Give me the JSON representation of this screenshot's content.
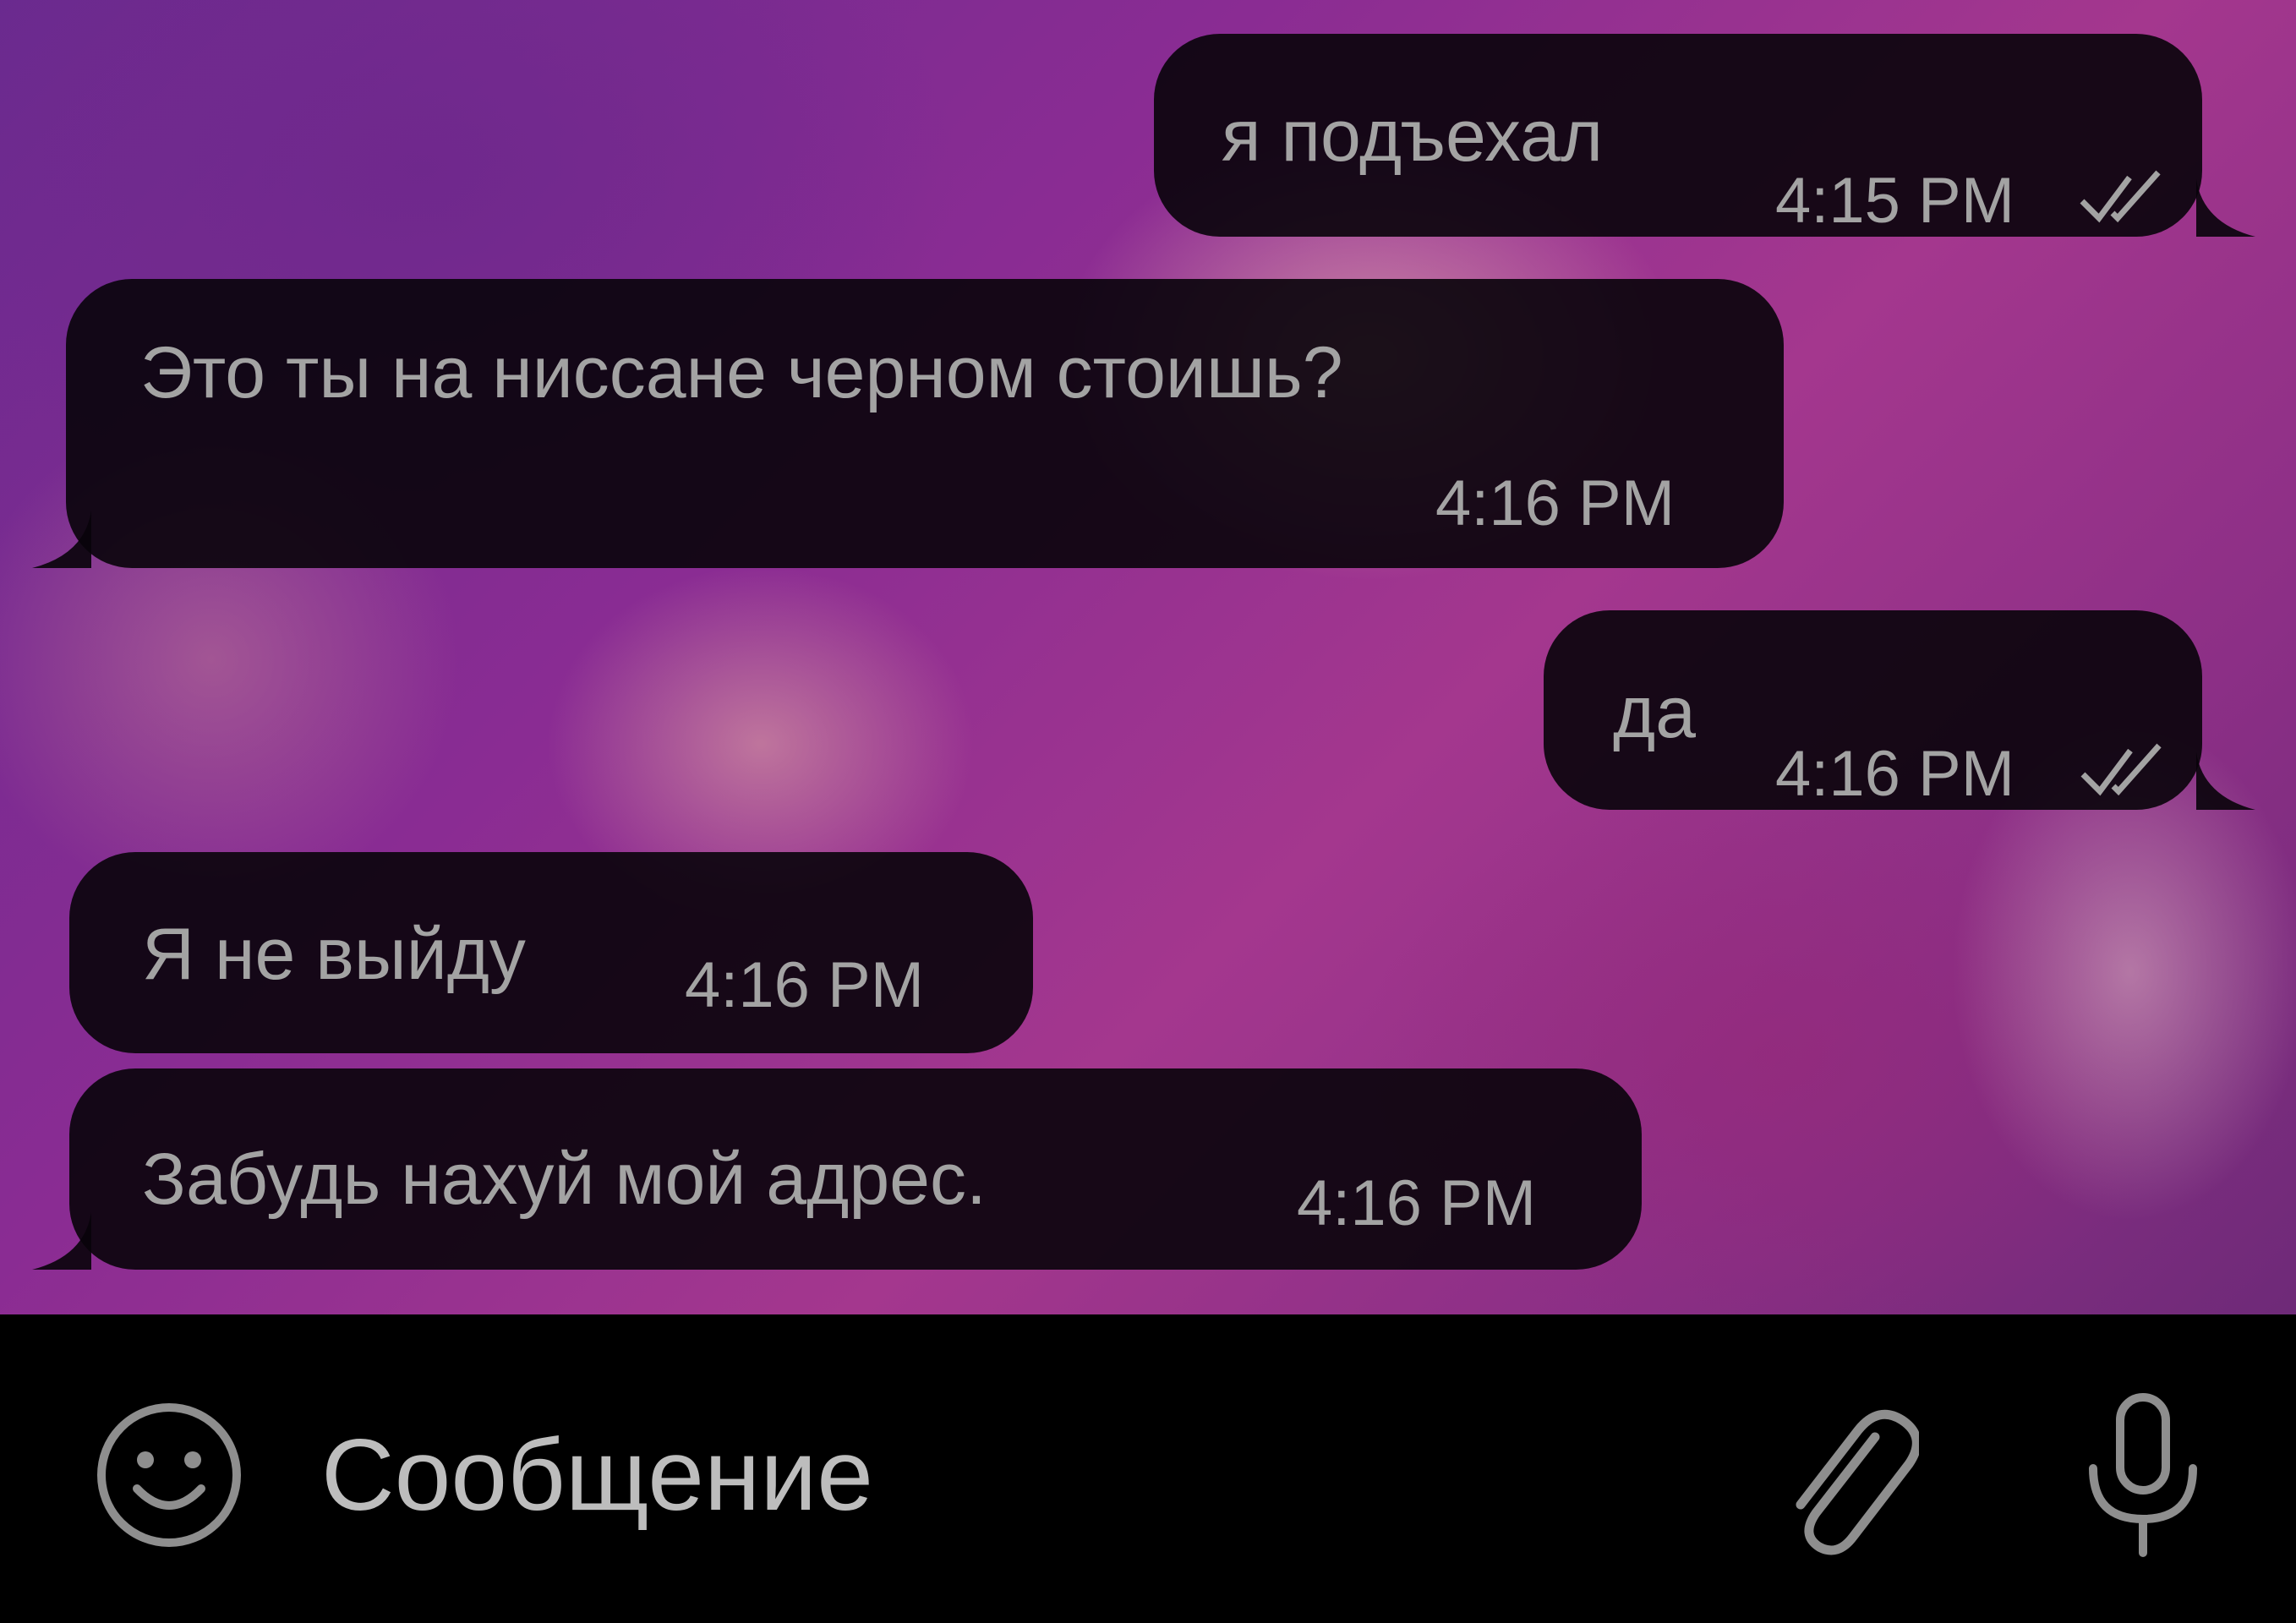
{
  "messages": [
    {
      "id": "m1",
      "direction": "outgoing",
      "text": "я подъехал",
      "time": "4:15 PM",
      "status_icon": "double-check-icon"
    },
    {
      "id": "m2",
      "direction": "incoming",
      "text": "Это ты на ниссане черном стоишь?",
      "time": "4:16 PM"
    },
    {
      "id": "m3",
      "direction": "outgoing",
      "text": "да",
      "time": "4:16 PM",
      "status_icon": "double-check-icon"
    },
    {
      "id": "m4",
      "direction": "incoming",
      "text": "Я не выйду",
      "time": "4:16 PM"
    },
    {
      "id": "m5",
      "direction": "incoming",
      "text": "Забудь нахуй мой адрес.",
      "time": "4:16 PM"
    }
  ],
  "input": {
    "placeholder": "Сообщение",
    "emoji_icon": "smiley-icon",
    "attach_icon": "paperclip-icon",
    "voice_icon": "microphone-icon"
  },
  "colors": {
    "bubble_bg": "#08030a",
    "bubble_text": "#a3a3a3",
    "input_bar_bg": "#000000",
    "icon_color": "#8e8e8e",
    "wallpaper_accent": "#8a2c93"
  }
}
